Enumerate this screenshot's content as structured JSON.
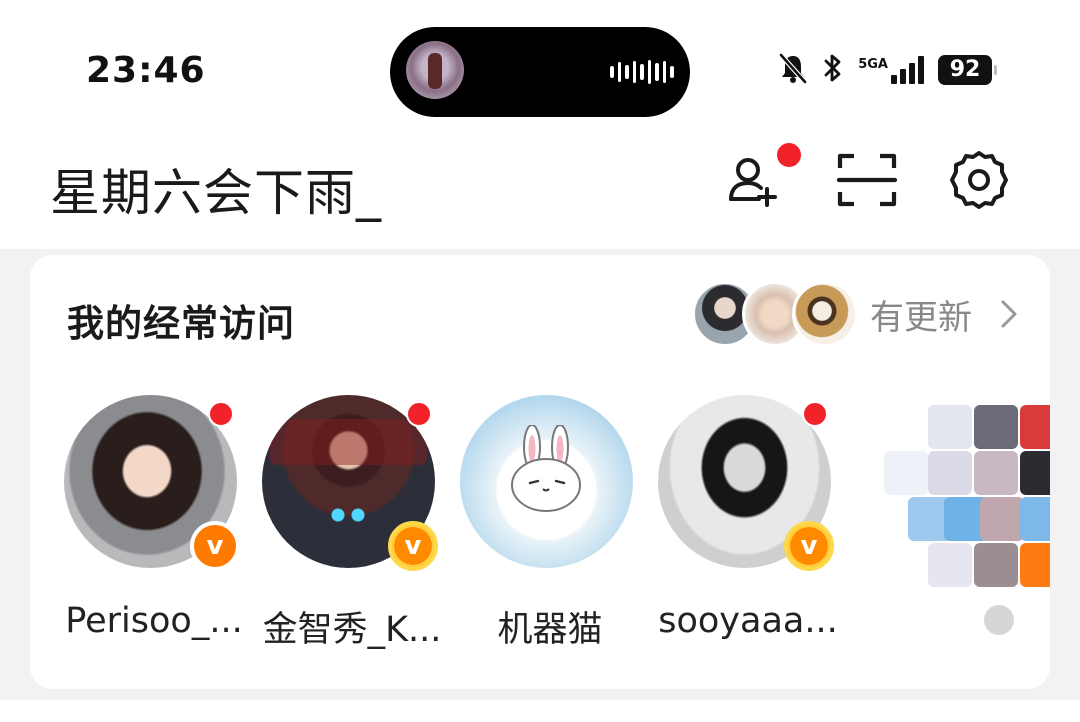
{
  "status_bar": {
    "time": "23:46",
    "network": "5GA",
    "battery": "92",
    "icons": [
      "silent-bell-icon",
      "bluetooth-icon",
      "signal-icon",
      "battery-icon"
    ]
  },
  "dynamic_island": {
    "media": "now-playing-thumbnail",
    "indicator": "waveform-icon"
  },
  "header": {
    "username": "星期六会下雨_",
    "actions": [
      "add-friend-icon",
      "scan-icon",
      "settings-icon"
    ],
    "friend_notification": true
  },
  "frequent_visits": {
    "title": "我的经常访问",
    "updates_label": "有更新",
    "items": [
      {
        "name": "Perisoo_...",
        "verified": true,
        "has_update": true
      },
      {
        "name": "金智秀_K...",
        "verified": true,
        "has_update": true
      },
      {
        "name": "机器猫",
        "verified": false,
        "has_update": false
      },
      {
        "name": "sooyaaa...",
        "verified": true,
        "has_update": true
      }
    ]
  },
  "colors": {
    "accent_red": "#f2222a",
    "badge_orange": "#ff7a00",
    "background": "#f2f2f4"
  }
}
